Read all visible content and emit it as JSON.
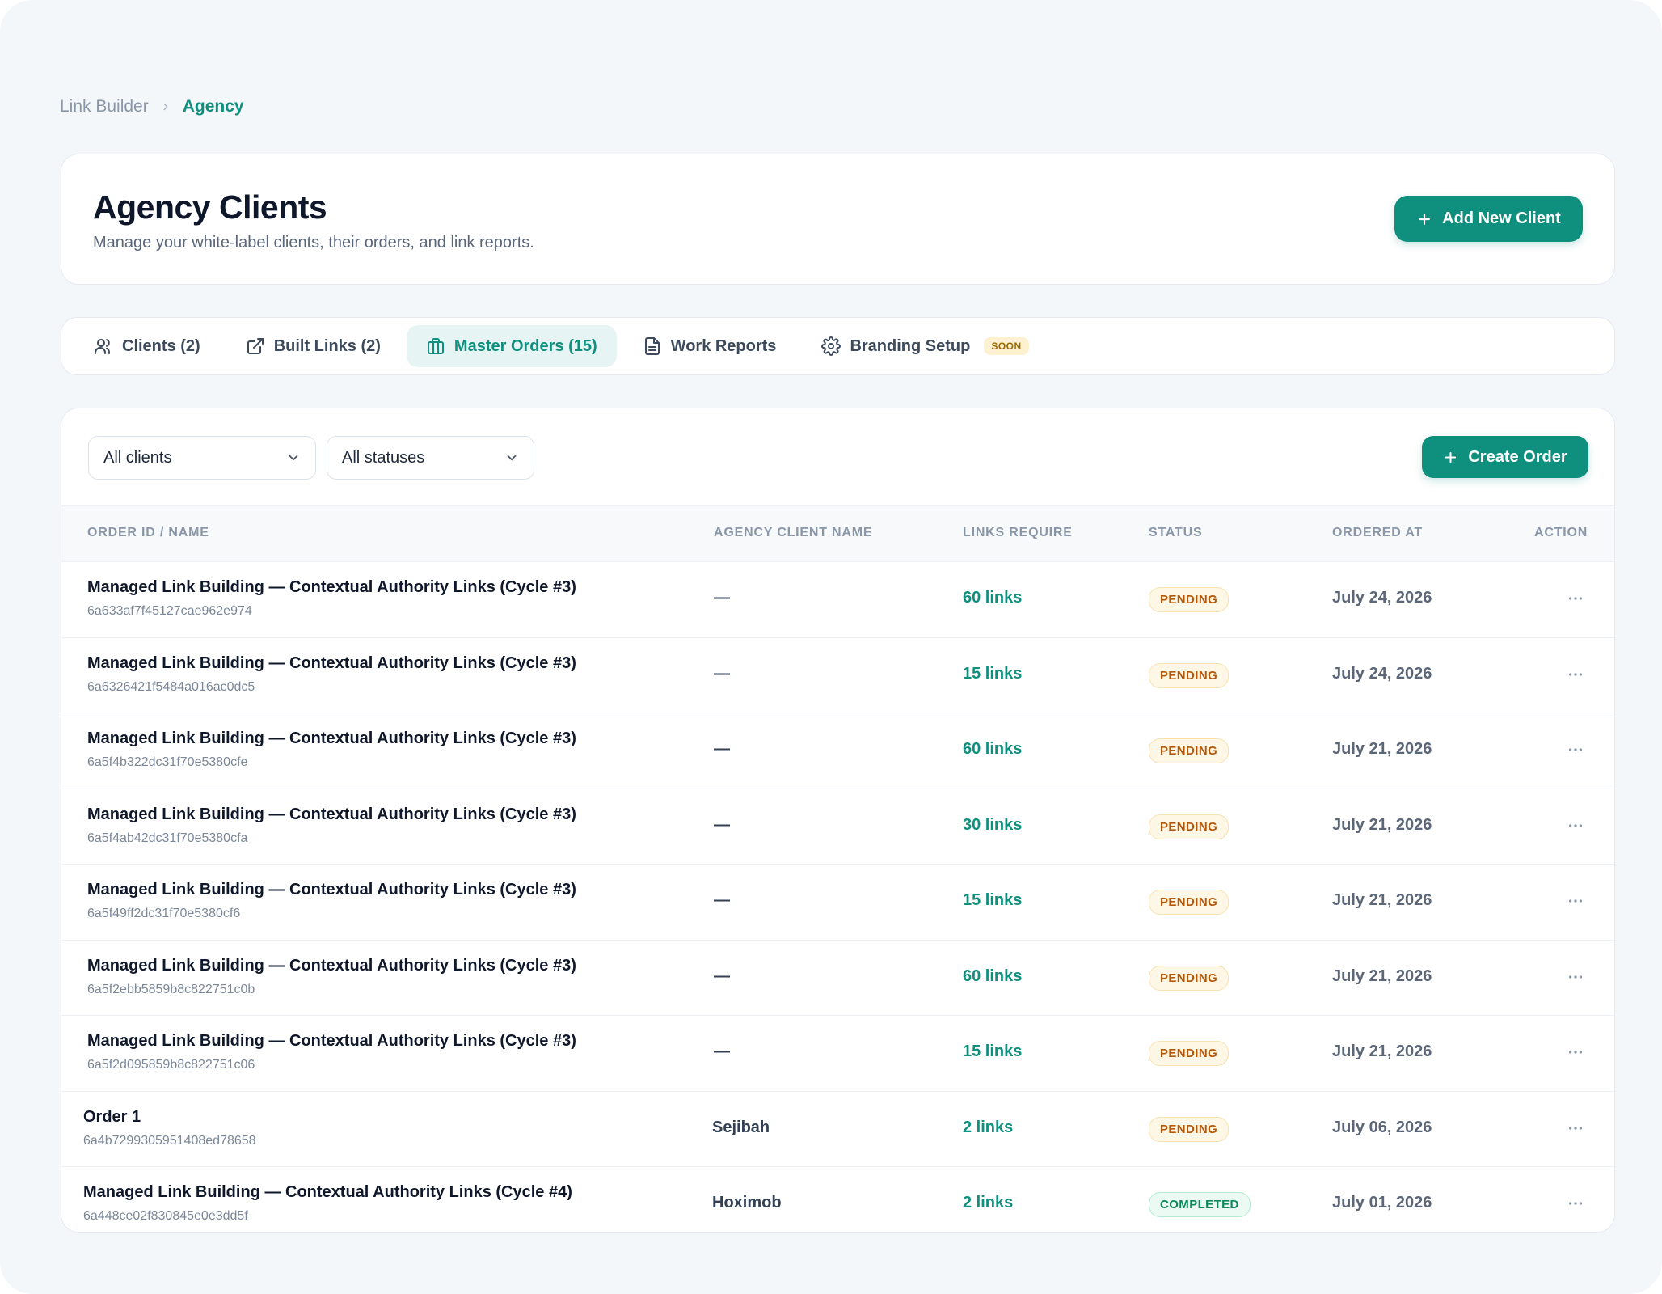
{
  "breadcrumb": {
    "parent": "Link Builder",
    "current": "Agency"
  },
  "header": {
    "title": "Agency Clients",
    "subtitle": "Manage your white-label clients, their orders, and link reports.",
    "add_button": "Add New Client"
  },
  "tabs": [
    {
      "label": "Clients (2)",
      "icon": "users-icon"
    },
    {
      "label": "Built Links (2)",
      "icon": "external-link-icon"
    },
    {
      "label": "Master Orders (15)",
      "icon": "briefcase-icon",
      "active": true
    },
    {
      "label": "Work Reports",
      "icon": "file-text-icon"
    },
    {
      "label": "Branding Setup",
      "icon": "gear-icon",
      "badge": "SOON"
    }
  ],
  "filters": {
    "clients": "All clients",
    "statuses": "All statuses",
    "create_button": "Create Order"
  },
  "table": {
    "columns": [
      "ORDER ID / NAME",
      "AGENCY CLIENT NAME",
      "LINKS REQUIRE",
      "STATUS",
      "ORDERED AT",
      "ACTION"
    ],
    "rows": [
      {
        "name": "Managed Link Building — Contextual Authority Links (Cycle #3)",
        "id": "6a633af7f45127cae962e974",
        "client": "—",
        "links": "60 links",
        "status": "PENDING",
        "ordered": "July 24, 2026"
      },
      {
        "name": "Managed Link Building — Contextual Authority Links (Cycle #3)",
        "id": "6a6326421f5484a016ac0dc5",
        "client": "—",
        "links": "15 links",
        "status": "PENDING",
        "ordered": "July 24, 2026"
      },
      {
        "name": "Managed Link Building — Contextual Authority Links (Cycle #3)",
        "id": "6a5f4b322dc31f70e5380cfe",
        "client": "—",
        "links": "60 links",
        "status": "PENDING",
        "ordered": "July 21, 2026"
      },
      {
        "name": "Managed Link Building — Contextual Authority Links (Cycle #3)",
        "id": "6a5f4ab42dc31f70e5380cfa",
        "client": "—",
        "links": "30 links",
        "status": "PENDING",
        "ordered": "July 21, 2026"
      },
      {
        "name": "Managed Link Building — Contextual Authority Links (Cycle #3)",
        "id": "6a5f49ff2dc31f70e5380cf6",
        "client": "—",
        "links": "15 links",
        "status": "PENDING",
        "ordered": "July 21, 2026"
      },
      {
        "name": "Managed Link Building — Contextual Authority Links (Cycle #3)",
        "id": "6a5f2ebb5859b8c822751c0b",
        "client": "—",
        "links": "60 links",
        "status": "PENDING",
        "ordered": "July 21, 2026"
      },
      {
        "name": "Managed Link Building — Contextual Authority Links (Cycle #3)",
        "id": "6a5f2d095859b8c822751c06",
        "client": "—",
        "links": "15 links",
        "status": "PENDING",
        "ordered": "July 21, 2026"
      },
      {
        "name": "Order 1",
        "id": "6a4b7299305951408ed78658",
        "client": "Sejibah",
        "links": "2 links",
        "status": "PENDING",
        "ordered": "July 06, 2026"
      },
      {
        "name": "Managed Link Building — Contextual Authority Links (Cycle #4)",
        "id": "6a448ce02f830845e0e3dd5f",
        "client": "Hoximob",
        "links": "2 links",
        "status": "COMPLETED",
        "ordered": "July 01, 2026"
      }
    ]
  },
  "colors": {
    "accent": "#0f8f7e",
    "pending": "#b4590a",
    "completed": "#0c8a5c"
  }
}
